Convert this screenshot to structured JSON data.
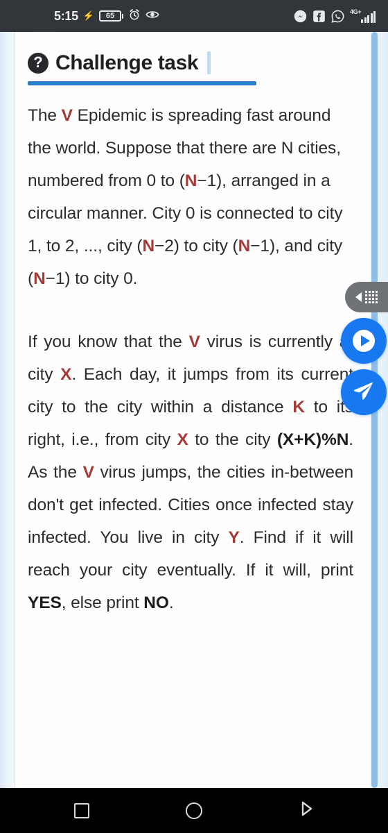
{
  "status_bar": {
    "clock": "5:15",
    "charging_icon": "bolt-icon",
    "battery_level": "65",
    "alarm_icon": "alarm-clock-icon",
    "eye_icon": "eye-icon",
    "app_icons": [
      "messenger-icon",
      "facebook-icon",
      "whatsapp-icon"
    ],
    "network_label": "4G+",
    "signal_bars": 5,
    "background_color": "#323539"
  },
  "header": {
    "icon": "question-mark-circle-icon",
    "title": "Challenge task",
    "underline_color": "#2a7fc9",
    "caret_color": "#bcdcf3"
  },
  "problem": {
    "paragraph_1": {
      "segment_1": "The ",
      "var_v_1": "V",
      "segment_2": " Epidemic is spreading fast around the world. Suppose that there are N cities, numbered from 0 to (",
      "var_n_1": "N",
      "segment_3": "−1), arranged in a circular manner. City 0 is connected to city 1,  to 2, ..., city (",
      "var_n_2": "N",
      "segment_4": "−2) to city (",
      "var_n_3": "N",
      "segment_5": "−1), and city (",
      "var_n_4": "N",
      "segment_6": "−1) to city 0."
    },
    "paragraph_2": {
      "segment_1": "If you know that the ",
      "var_v_1": "V",
      "segment_2": " virus is currently at city ",
      "var_x_1": "X",
      "segment_3": ". Each day, it jumps from its current city to the city within a distance ",
      "var_k_1": "K",
      "segment_4": " to its right, i.e., from city ",
      "var_x_2": "X",
      "segment_5": " to the city ",
      "formula": "(X+K)%N",
      "segment_6": ". As the ",
      "var_v_2": "V",
      "segment_7": " virus jumps, the cities in-between don't get infected. Cities once infected stay infected. You live in city ",
      "var_y_1": "Y",
      "segment_8": ". Find if it will reach your city eventually. If it will, print ",
      "answer_yes": "YES",
      "segment_9": ", else print ",
      "answer_no": "NO",
      "segment_10": "."
    },
    "highlight_color": "#a33a38"
  },
  "floating_buttons": [
    {
      "name": "collapse-grid-toolbar",
      "icon": "left-arrow-grid-icon",
      "color": "#6f7378"
    },
    {
      "name": "play-video-button",
      "icon": "play-circle-icon",
      "color": "#1878f0"
    },
    {
      "name": "send-submit-button",
      "icon": "send-paper-plane-icon",
      "color": "#1878f0"
    }
  ],
  "nav_bar": {
    "recents_icon": "square-recents-icon",
    "home_icon": "circle-home-icon",
    "back_icon": "triangle-back-icon",
    "background_color": "#000000"
  }
}
